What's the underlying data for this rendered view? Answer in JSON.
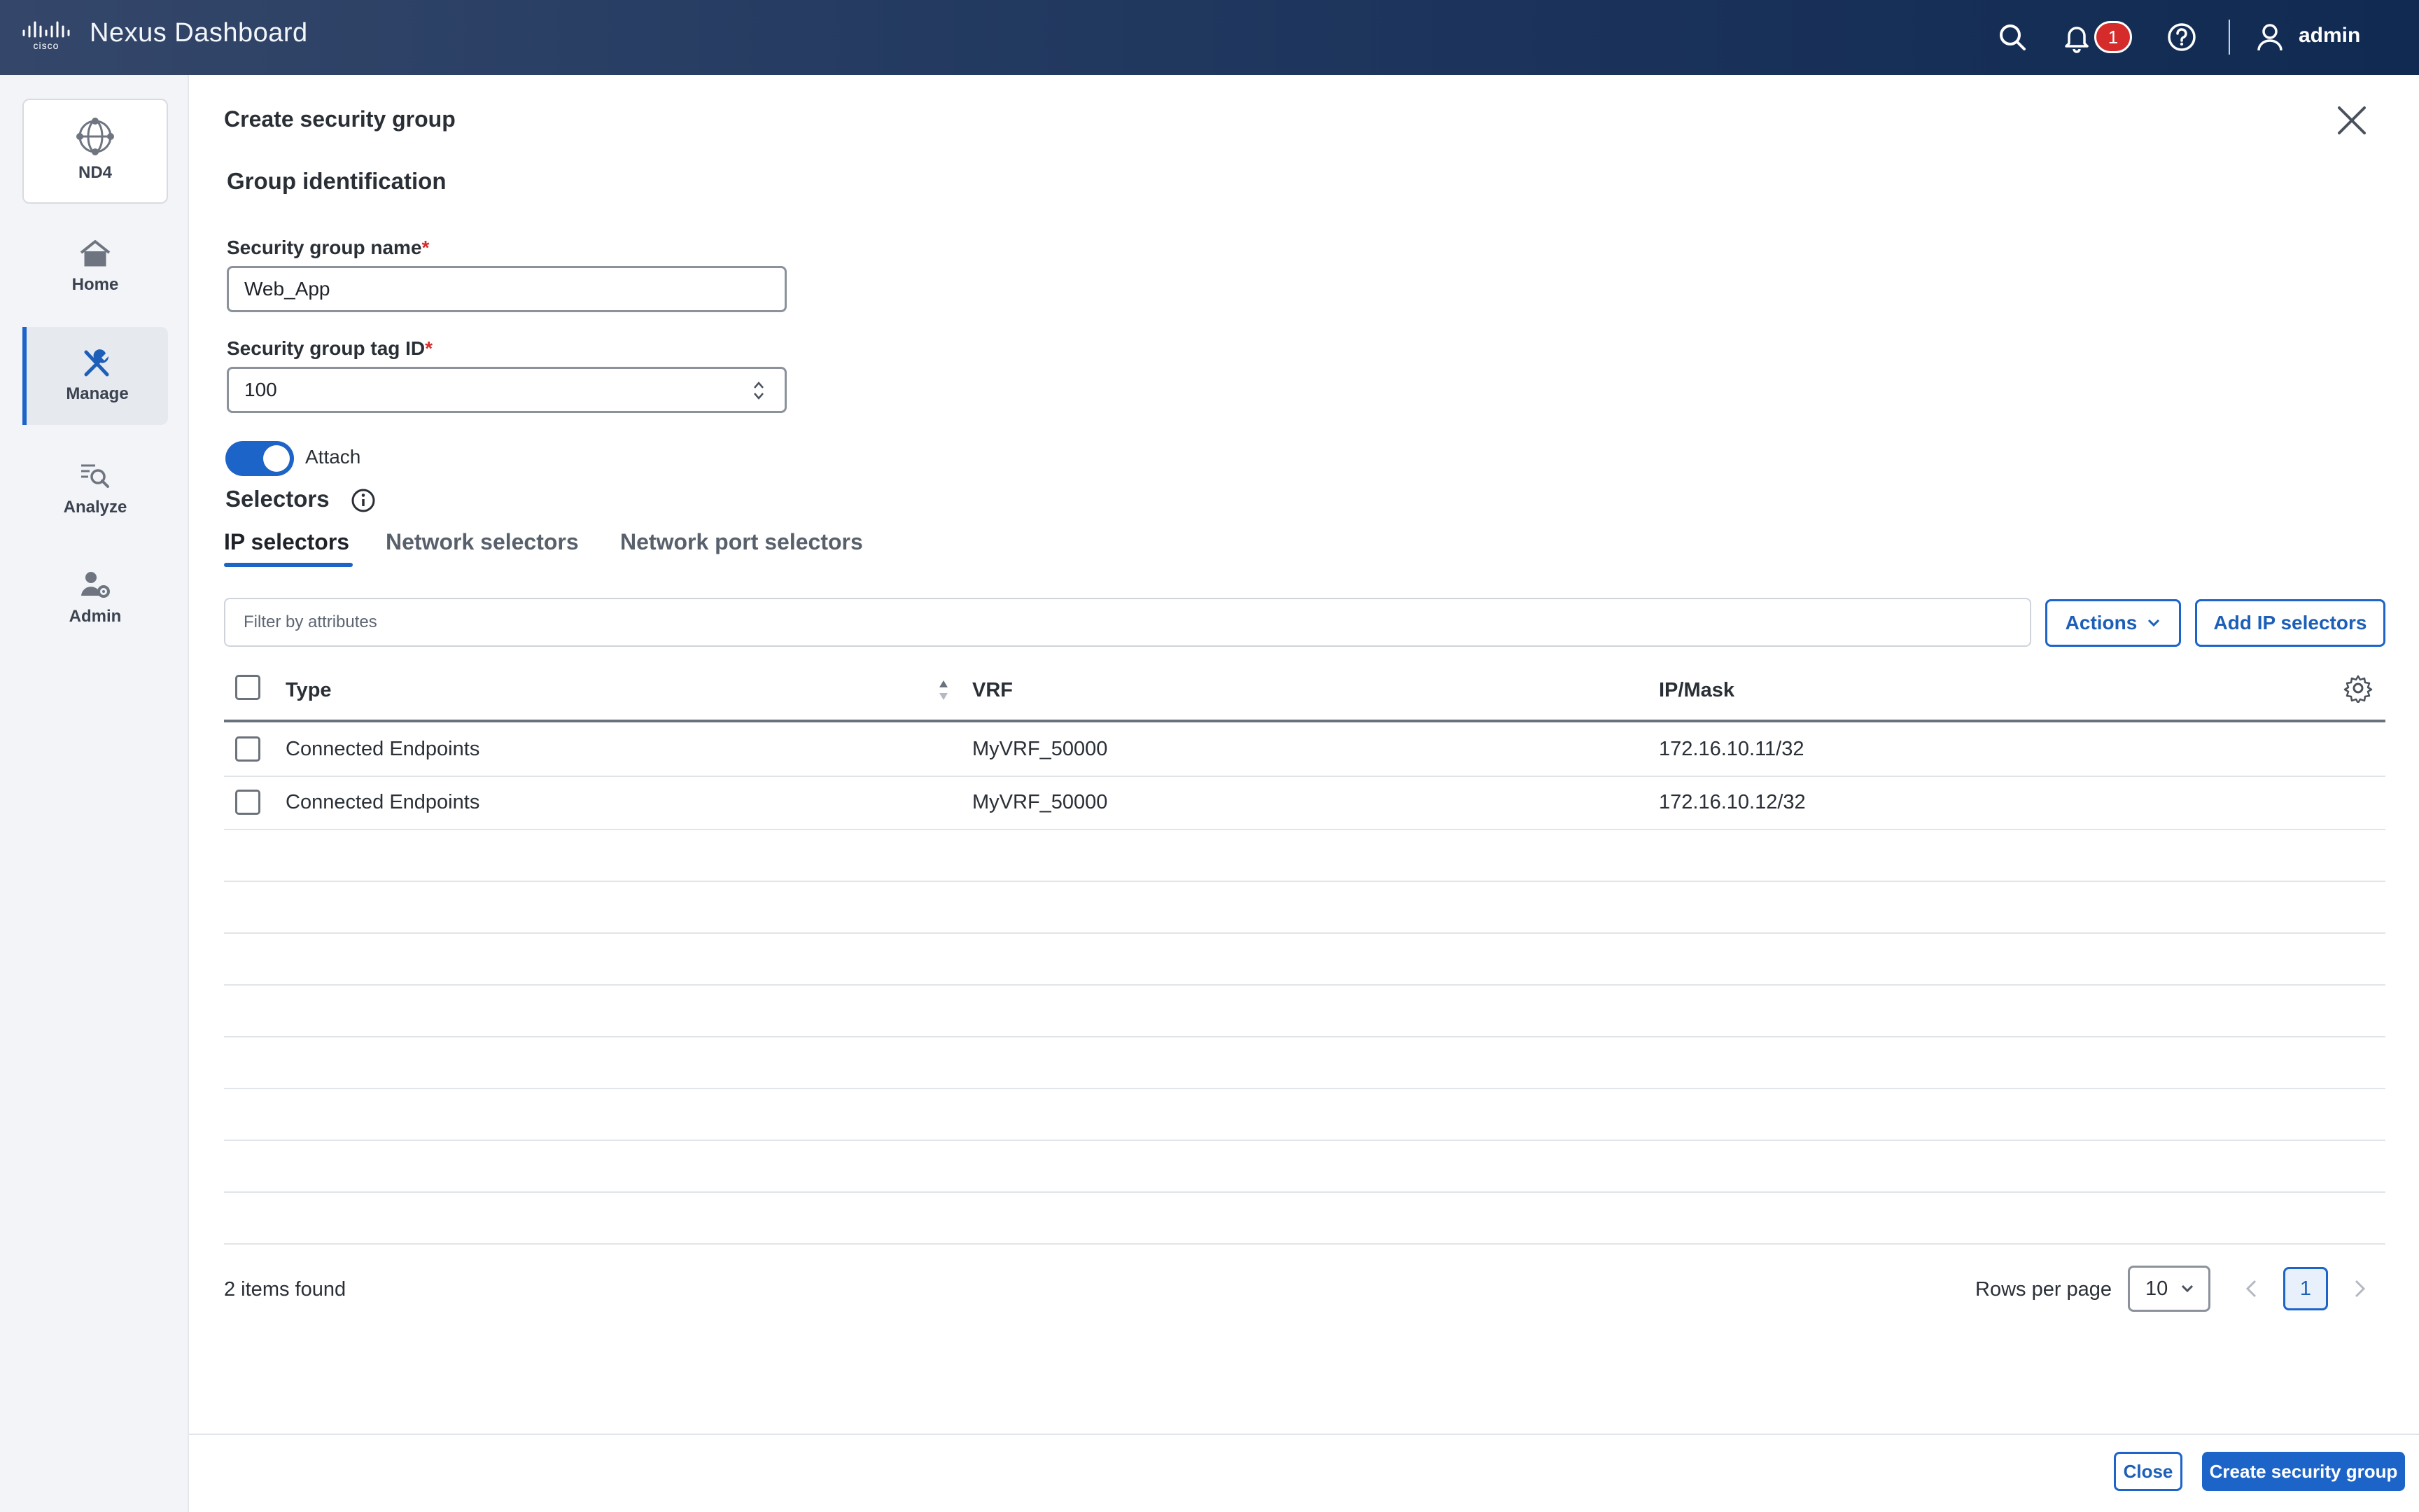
{
  "header": {
    "app_title": "Nexus Dashboard",
    "notification_count": "1",
    "user_name": "admin"
  },
  "sidebar": {
    "items": [
      {
        "label": "ND4",
        "icon": "globe-icon"
      },
      {
        "label": "Home",
        "icon": "home-icon"
      },
      {
        "label": "Manage",
        "icon": "tools-icon",
        "active": true
      },
      {
        "label": "Analyze",
        "icon": "search-list-icon"
      },
      {
        "label": "Admin",
        "icon": "user-gear-icon"
      }
    ]
  },
  "dialog": {
    "title": "Create security group",
    "section_title": "Group identification",
    "name_label": "Security group name",
    "name_value": "Web_App",
    "tag_label": "Security group tag ID",
    "tag_value": "100",
    "required_mark": "*",
    "attach_label": "Attach",
    "attach_on": true,
    "selectors_title": "Selectors"
  },
  "tabs": [
    {
      "label": "IP selectors",
      "active": true
    },
    {
      "label": "Network selectors"
    },
    {
      "label": "Network port selectors"
    }
  ],
  "toolbar": {
    "filter_placeholder": "Filter by attributes",
    "actions_label": "Actions",
    "add_label": "Add IP selectors"
  },
  "table": {
    "columns": [
      "Type",
      "VRF",
      "IP/Mask"
    ],
    "rows": [
      {
        "type": "Connected Endpoints",
        "vrf": "MyVRF_50000",
        "ip": "172.16.10.11/32"
      },
      {
        "type": "Connected Endpoints",
        "vrf": "MyVRF_50000",
        "ip": "172.16.10.12/32"
      }
    ]
  },
  "pagination": {
    "items_found": "2 items found",
    "rows_per_page_label": "Rows per page",
    "rows_per_page": "10",
    "current_page": "1"
  },
  "footer": {
    "close_label": "Close",
    "create_label": "Create security group"
  },
  "colors": {
    "accent": "#1d64c8",
    "required": "#d62b2b",
    "header_bg": "#21385f"
  }
}
